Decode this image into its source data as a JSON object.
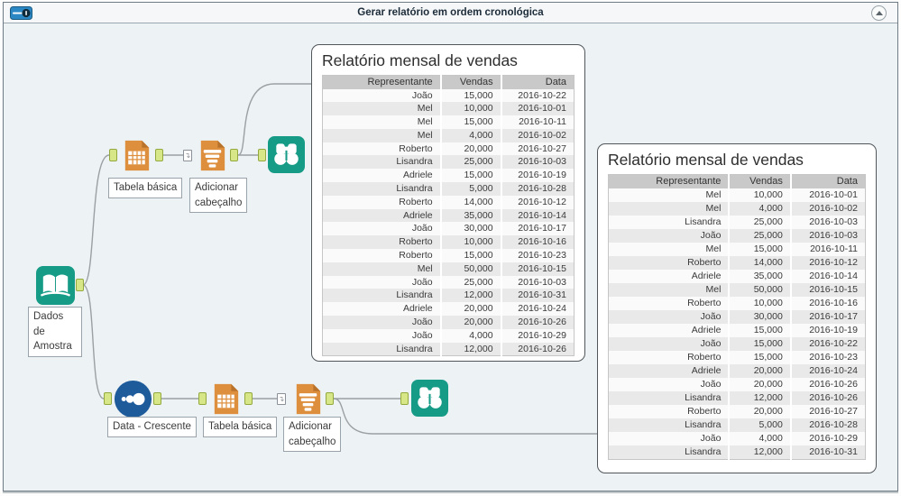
{
  "window": {
    "title": "Gerar relatório em ordem cronológica"
  },
  "tools": [
    {
      "id": "input-data",
      "label": "Dados de Amostra"
    },
    {
      "id": "table-top",
      "label": "Tabela básica"
    },
    {
      "id": "header-top",
      "label": "Adicionar cabeçalho"
    },
    {
      "id": "sort",
      "label": "Data - Crescente"
    },
    {
      "id": "table-bottom",
      "label": "Tabela básica"
    },
    {
      "id": "header-bottom",
      "label": "Adicionar cabeçalho"
    }
  ],
  "icons": {
    "input_data": "open-book-icon",
    "table": "table-document-icon",
    "header": "header-document-icon",
    "browse": "binoculars-icon",
    "sort": "dots-ascending-icon",
    "titlebar": "tool-container-icon",
    "collapse": "chevron-up-icon"
  },
  "colors": {
    "teal_tool": "#169b87",
    "orange_tool": "#de8f3e",
    "blue_tool": "#1e5b9b",
    "anchor_green": "#d7e788",
    "canvas_bg": "#edf2f4",
    "table_header_bg": "#c9c9c9",
    "row_stripe": "#e9e9e9"
  },
  "reports": [
    {
      "title": "Relatório mensal de vendas",
      "columns": [
        "Representante",
        "Vendas",
        "Data"
      ],
      "rows": [
        [
          "João",
          "15,000",
          "2016-10-22"
        ],
        [
          "Mel",
          "10,000",
          "2016-10-01"
        ],
        [
          "Mel",
          "15,000",
          "2016-10-11"
        ],
        [
          "Mel",
          "4,000",
          "2016-10-02"
        ],
        [
          "Roberto",
          "20,000",
          "2016-10-27"
        ],
        [
          "Lisandra",
          "25,000",
          "2016-10-03"
        ],
        [
          "Adriele",
          "15,000",
          "2016-10-19"
        ],
        [
          "Lisandra",
          "5,000",
          "2016-10-28"
        ],
        [
          "Roberto",
          "14,000",
          "2016-10-12"
        ],
        [
          "Adriele",
          "35,000",
          "2016-10-14"
        ],
        [
          "João",
          "30,000",
          "2016-10-17"
        ],
        [
          "Roberto",
          "10,000",
          "2016-10-16"
        ],
        [
          "Roberto",
          "15,000",
          "2016-10-23"
        ],
        [
          "Mel",
          "50,000",
          "2016-10-15"
        ],
        [
          "João",
          "25,000",
          "2016-10-03"
        ],
        [
          "Lisandra",
          "12,000",
          "2016-10-31"
        ],
        [
          "Adriele",
          "20,000",
          "2016-10-24"
        ],
        [
          "João",
          "20,000",
          "2016-10-26"
        ],
        [
          "João",
          "4,000",
          "2016-10-29"
        ],
        [
          "Lisandra",
          "12,000",
          "2016-10-26"
        ]
      ]
    },
    {
      "title": "Relatório mensal de vendas",
      "columns": [
        "Representante",
        "Vendas",
        "Data"
      ],
      "rows": [
        [
          "Mel",
          "10,000",
          "2016-10-01"
        ],
        [
          "Mel",
          "4,000",
          "2016-10-02"
        ],
        [
          "Lisandra",
          "25,000",
          "2016-10-03"
        ],
        [
          "João",
          "25,000",
          "2016-10-03"
        ],
        [
          "Mel",
          "15,000",
          "2016-10-11"
        ],
        [
          "Roberto",
          "14,000",
          "2016-10-12"
        ],
        [
          "Adriele",
          "35,000",
          "2016-10-14"
        ],
        [
          "Mel",
          "50,000",
          "2016-10-15"
        ],
        [
          "Roberto",
          "10,000",
          "2016-10-16"
        ],
        [
          "João",
          "30,000",
          "2016-10-17"
        ],
        [
          "Adriele",
          "15,000",
          "2016-10-19"
        ],
        [
          "João",
          "15,000",
          "2016-10-22"
        ],
        [
          "Roberto",
          "15,000",
          "2016-10-23"
        ],
        [
          "Adriele",
          "20,000",
          "2016-10-24"
        ],
        [
          "João",
          "20,000",
          "2016-10-26"
        ],
        [
          "Lisandra",
          "12,000",
          "2016-10-26"
        ],
        [
          "Roberto",
          "20,000",
          "2016-10-27"
        ],
        [
          "Lisandra",
          "5,000",
          "2016-10-28"
        ],
        [
          "João",
          "4,000",
          "2016-10-29"
        ],
        [
          "Lisandra",
          "12,000",
          "2016-10-31"
        ]
      ]
    }
  ]
}
